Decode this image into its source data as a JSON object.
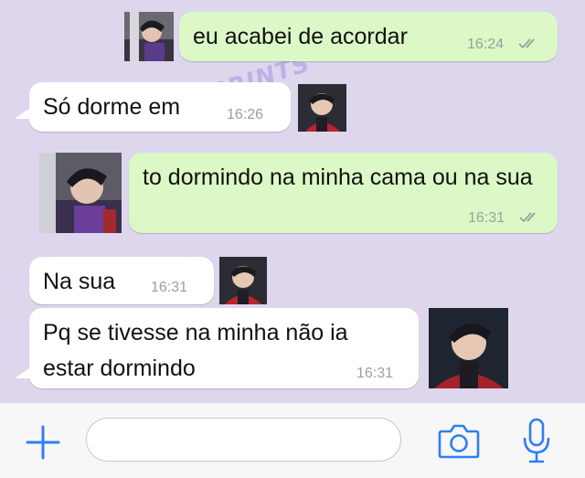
{
  "watermark": "@OSPRINTS",
  "messages": [
    {
      "direction": "out",
      "text": "eu acabei de acordar",
      "time": "16:24",
      "status": "read"
    },
    {
      "direction": "in",
      "text": "Só dorme em",
      "time": "16:26"
    },
    {
      "direction": "out",
      "text": "to dormindo na minha cama ou na sua",
      "time": "16:31",
      "status": "read"
    },
    {
      "direction": "in",
      "text": "Na sua",
      "time": "16:31"
    },
    {
      "direction": "in",
      "text": "Pq se tivesse na minha não ia estar dormindo",
      "time": "16:31"
    }
  ],
  "input": {
    "value": "",
    "placeholder": ""
  },
  "icons": {
    "attach": "plus-icon",
    "camera": "camera-icon",
    "mic": "microphone-icon",
    "read": "double-check-icon"
  },
  "colors": {
    "background": "#ddd6ec",
    "outgoing_bubble": "#dbf8c6",
    "incoming_bubble": "#ffffff",
    "accent": "#2f7ef5"
  }
}
